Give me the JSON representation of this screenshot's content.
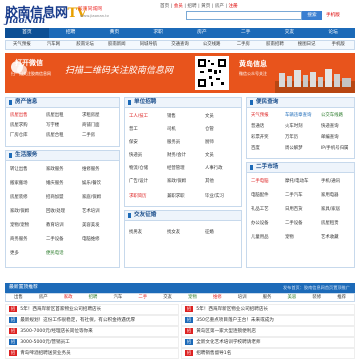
{
  "header": {
    "logo_cn": "胶南信息网",
    "logo_tv": "TV",
    "logo_en": "JiaoNan",
    "slogan": "胶南同城网",
    "domain": "www.jiaonan.tv",
    "top_links": [
      "首页",
      "会员",
      "招聘",
      "黄页",
      "房产",
      "注册"
    ],
    "top_sep": "|",
    "search_placeholder": "",
    "search_btn": "搜索",
    "phone": "手机版"
  },
  "nav": [
    "首页",
    "招聘",
    "黄页",
    "求职",
    "房产",
    "二手",
    "交友",
    "论坛"
  ],
  "subnav": [
    "天气预报",
    "汽车网",
    "胶南论坛",
    "胶南新闻",
    "同城导航",
    "交通查询",
    "公交线路",
    "二手房",
    "胶南招聘",
    "搜图日记",
    "手机版"
  ],
  "banner": {
    "wx_title": "打开微信",
    "wx_sub": "扫一扫关注胶南信息网",
    "slogan": "扫描二维码关注胶南信息网",
    "yt_title": "黄岛信息",
    "yt_sub": "微信公众号关注"
  },
  "house": {
    "title": "房产信息",
    "items": [
      [
        "房屋出售",
        "房屋出租",
        "求租房屋"
      ],
      [
        "房屋求购",
        "写字楼",
        "商铺门面"
      ],
      [
        "厂房仓库",
        "房屋合租",
        "二手房"
      ]
    ]
  },
  "life": {
    "title": "生活服务",
    "items": [
      [
        "转让出售",
        "家政服务",
        "维修服务"
      ],
      [
        "搬家搬场",
        "婚庆服务",
        "娱乐/餐饮"
      ],
      [
        "房屋装修",
        "招商加盟",
        "家庭/保姆"
      ],
      [
        "家政/保姆",
        "回收/处理",
        "艺术培训"
      ],
      [
        "宠物/宠物",
        "教育培训",
        "美容美发"
      ],
      [
        "商务服务",
        "二手设备",
        "电脑维修"
      ],
      [
        "更多",
        "便民电话",
        ""
      ]
    ]
  },
  "jobs": {
    "title": "单位招聘",
    "items": [
      [
        "工人/技工",
        "销售",
        "文员"
      ],
      [
        "普工",
        "司机",
        "仓管"
      ],
      [
        "保安",
        "服务员",
        "厨师"
      ],
      [
        "快递员",
        "财务/会计",
        "文员"
      ],
      [
        "物流/仓储",
        "经营管理",
        "人事行政"
      ],
      [
        "广告/设计",
        "家政/保姆",
        "其他"
      ],
      [
        "美容/美发",
        "餐饮/服务",
        ""
      ]
    ]
  },
  "seek": {
    "items": [
      [
        "求职简历",
        "兼职求职",
        "毕业/实习"
      ]
    ]
  },
  "friend": {
    "title": "交友征婚",
    "items": [
      [
        "找男友",
        "找女友",
        "征婚"
      ]
    ]
  },
  "convenience": {
    "title": "便民查询",
    "items": [
      [
        "天气预报",
        "车辆违章查询",
        "公交车线路"
      ],
      [
        "普通话",
        "火车时刻",
        "快递查询"
      ],
      [
        "彩票开奖",
        "万年历",
        "邮编查询"
      ],
      [
        "百度",
        "周公解梦",
        "IP/手机号归属"
      ]
    ]
  },
  "market": {
    "title": "二手市场",
    "items": [
      [
        "二手电脑",
        "摩托/电动车",
        "手机/通讯"
      ],
      [
        "电脑配件",
        "二手汽车",
        "家用电器"
      ],
      [
        "礼品工艺",
        "日用百货",
        "家具/家居"
      ],
      [
        "办公设备",
        "二手设备",
        "房屋租赁"
      ],
      [
        "儿童用品",
        "宠物",
        "艺术收藏"
      ]
    ]
  },
  "ads": [
    {
      "tag": "招",
      "text": "5年！西海岸新区首家物业公司招聘店长"
    },
    {
      "tag": "招",
      "text": "最新规划！这份工作很稳定，有社保，有公积金待遇优厚"
    },
    {
      "tag": "招",
      "text": "3500-7000元/经理店长岗位等你来"
    },
    {
      "tag": "招",
      "text": "3000-5000元/营销员工"
    },
    {
      "tag": "招",
      "text": "青岛啤酒招聘送货业务员"
    }
  ],
  "ads_right": [
    {
      "tag": "招",
      "text": "5年！西海岸新区物业公司招聘店长"
    },
    {
      "tag": "招",
      "text": "350亿重点项目落户王台！未来或成为"
    },
    {
      "tag": "招",
      "text": "黄岛区第一家大型连锁便利店"
    },
    {
      "tag": "招",
      "text": "全新文化艺术培训学校聘请老师"
    },
    {
      "tag": "招",
      "text": "招聘销售督导1名"
    }
  ],
  "hot": {
    "title": "最新置顶推荐",
    "right": "发布首页：胶南信息网首页置顶推广"
  },
  "cats": [
    "出售",
    "房产",
    "家政",
    "招聘",
    "汽车",
    "二手",
    "交友",
    "宠物",
    "维修",
    "培训",
    "服务",
    "美容",
    "装修",
    "推荐"
  ],
  "colors": {
    "brand": "#1c6ab8",
    "banner": "#e8541c",
    "accent": "#d22"
  }
}
